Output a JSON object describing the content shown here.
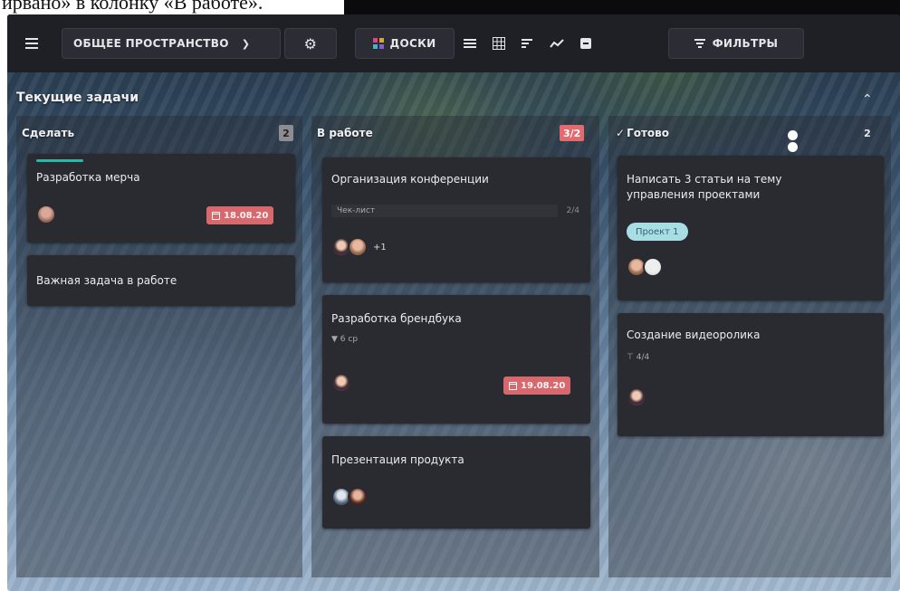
{
  "caption": "ирвано» в колонку «В работе».",
  "toolbar": {
    "workspace_label": "ОБЩЕЕ ПРОСТРАНСТВО",
    "boards_label": "ДОСКИ",
    "filters_label": "ФИЛЬТРЫ"
  },
  "board": {
    "title": "Текущие задачи",
    "columns": [
      {
        "title": "Сделать",
        "count": "2",
        "cards": [
          {
            "title": "Разработка мерча",
            "date": "18.08.20"
          },
          {
            "title": "Важная задача в работе"
          }
        ]
      },
      {
        "title": "В работе",
        "count": "3/2",
        "cards": [
          {
            "title": "Организация конференции",
            "meta": "Чек-лист",
            "progress": "2/4",
            "more": "+1"
          },
          {
            "title": "Разработка брендбука",
            "meta": "6 ср",
            "date": "19.08.20"
          },
          {
            "title": "Презентация продукта"
          }
        ]
      },
      {
        "title": "Готово",
        "count": "2",
        "cards": [
          {
            "title_line1": "Написать 3 статьи на тему",
            "title_line2": "управления проектами",
            "tag": "Проект 1"
          },
          {
            "title": "Создание видеоролика",
            "meta": "4/4"
          }
        ]
      }
    ]
  },
  "colors": {
    "toolbar_bg": "#1f2026",
    "card_bg": "#2a2b31",
    "date_badge": "#d7686e",
    "count_badge_alert": "#e36a6e",
    "tag_bg": "#a8dde4",
    "accent": "#2bb8a8"
  }
}
